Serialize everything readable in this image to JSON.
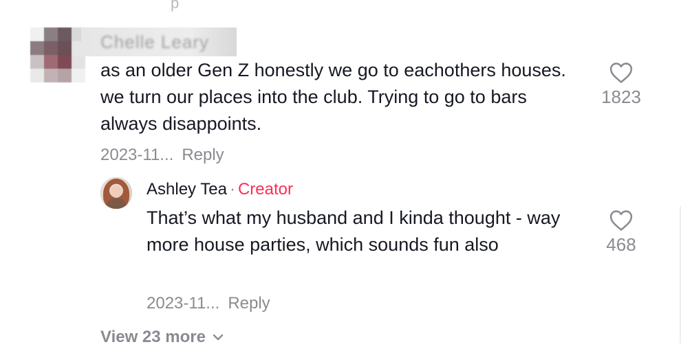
{
  "top_fragment": "p",
  "comment": {
    "username": "Chelle Leary",
    "text": "as an older Gen Z honestly we go to eachothers houses. we turn our places into the club. Trying to go to bars always disappoints.",
    "date": "2023-11...",
    "reply_label": "Reply",
    "likes": "1823"
  },
  "reply": {
    "username": "Ashley Tea",
    "separator": "·",
    "badge": "Creator",
    "text": "That’s what my husband and I kinda thought - way more house parties, which sounds fun also",
    "date": "2023-11...",
    "reply_label": "Reply",
    "likes": "468"
  },
  "view_more": {
    "label": "View 23 more"
  },
  "icons": {
    "like": "heart-outline-icon",
    "expand": "chevron-down-icon"
  },
  "colors": {
    "text": "#161823",
    "muted": "#8a8b91",
    "creator": "#fe2c55"
  }
}
